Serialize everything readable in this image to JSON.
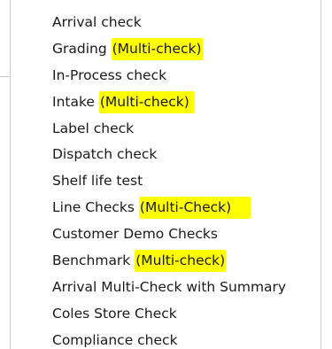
{
  "menu": {
    "items": [
      {
        "label": "Arrival check",
        "highlight": ""
      },
      {
        "label": "Grading ",
        "highlight": "(Multi-check)"
      },
      {
        "label": "In-Process check",
        "highlight": ""
      },
      {
        "label": "Intake ",
        "highlight": "(Multi-check)"
      },
      {
        "label": "Label check",
        "highlight": ""
      },
      {
        "label": "Dispatch check",
        "highlight": ""
      },
      {
        "label": "Shelf life test",
        "highlight": ""
      },
      {
        "label": "Line Checks ",
        "highlight": "(Multi-Check)"
      },
      {
        "label": "Customer Demo Checks",
        "highlight": ""
      },
      {
        "label": "Benchmark ",
        "highlight": "(Multi-check)"
      },
      {
        "label": "Arrival Multi-Check with Summary",
        "highlight": ""
      },
      {
        "label": "Coles Store Check",
        "highlight": ""
      },
      {
        "label": "Compliance check",
        "highlight": ""
      }
    ],
    "highlight_color": "#ffff00",
    "text_color": "#1a1a1a"
  }
}
